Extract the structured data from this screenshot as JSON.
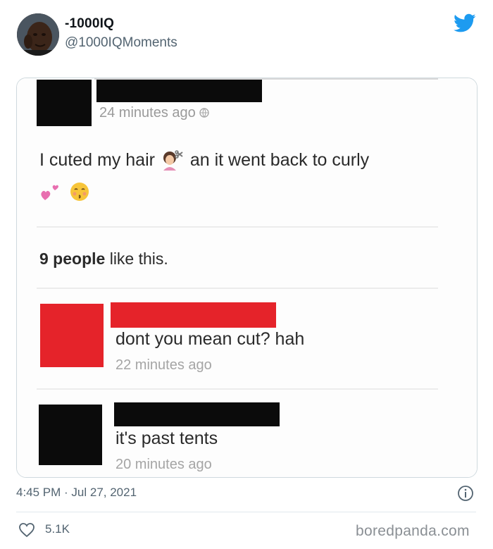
{
  "tweet": {
    "display_name": "-1000IQ",
    "handle": "@1000IQMoments",
    "timestamp": "4:45 PM · Jul 27, 2021",
    "like_count": "5.1K",
    "watermark": "boredpanda.com"
  },
  "screenshot": {
    "post_time": "24 minutes ago",
    "post_text_before": "I cuted my hair",
    "post_text_after": "an it went back to curly",
    "likes_bold": "9 people",
    "likes_rest": " like this.",
    "comments": [
      {
        "text": "dont you mean cut? hah",
        "time": "22 minutes ago",
        "redaction_color": "#e5232a"
      },
      {
        "text": "it's past tents",
        "time": "20 minutes ago",
        "redaction_color": "#0b0b0b"
      }
    ]
  },
  "colors": {
    "twitter_blue": "#1d9bf0",
    "muted_text": "#536471",
    "red_redaction": "#e5232a",
    "black_redaction": "#0b0b0b"
  },
  "icons": [
    "twitter-bird-icon",
    "haircut-emoji-icon",
    "two-hearts-emoji-icon",
    "kissing-face-emoji-icon",
    "info-icon",
    "heart-icon"
  ]
}
